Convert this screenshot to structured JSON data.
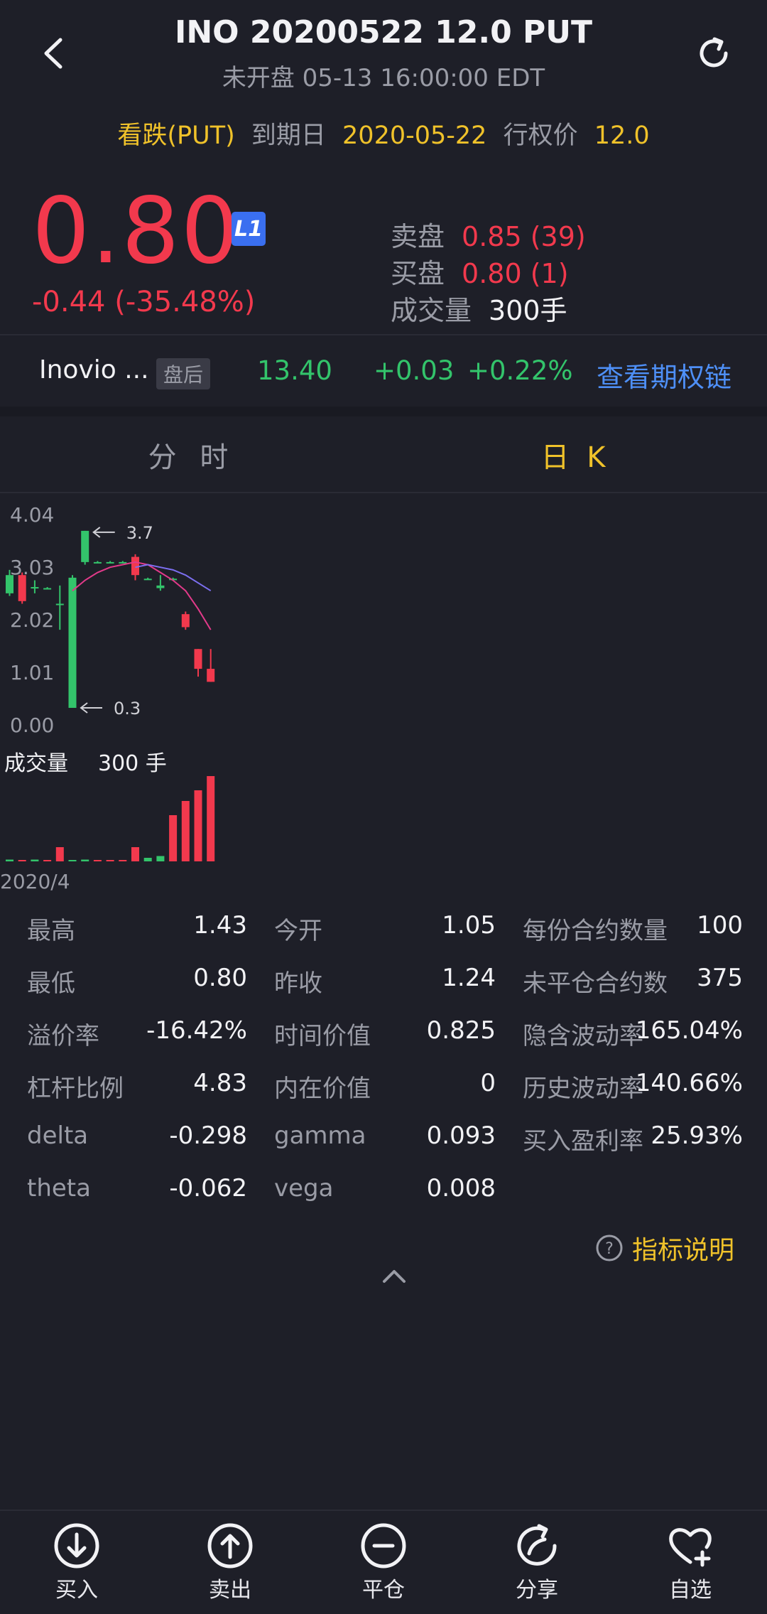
{
  "header": {
    "title": "INO 20200522 12.0 PUT",
    "subtitle": "未开盘 05-13 16:00:00 EDT"
  },
  "contract": {
    "type": "看跌(PUT)",
    "expiry_label": "到期日",
    "expiry_value": "2020-05-22",
    "strike_label": "行权价",
    "strike_value": "12.0"
  },
  "quote": {
    "price": "0.80",
    "level_badge": "L1",
    "change": "-0.44 (-35.48%)",
    "ask_label": "卖盘",
    "ask_value": "0.85 (39)",
    "bid_label": "买盘",
    "bid_value": "0.80 (1)",
    "volume_label": "成交量",
    "volume_value": "300手"
  },
  "underlying": {
    "name": "Inovio ...",
    "session_badge": "盘后",
    "price": "13.40",
    "change": "+0.03",
    "change_pct": "+0.22%",
    "chain_link": "查看期权链"
  },
  "tabs": {
    "intraday": "分 时",
    "daily": "日 K"
  },
  "chart_data": {
    "type": "candlestick",
    "y_ticks": [
      "4.04",
      "3.03",
      "2.02",
      "1.01",
      "0.00"
    ],
    "ylim": [
      0,
      4.04
    ],
    "high_marker": "3.7",
    "low_marker": "0.3",
    "volume_label": "成交量",
    "volume_value": "300 手",
    "x_start_label": "2020/4",
    "candles": [
      {
        "o": 2.5,
        "c": 2.85,
        "h": 2.95,
        "l": 2.45
      },
      {
        "o": 2.85,
        "c": 2.35,
        "h": 2.9,
        "l": 2.3
      },
      {
        "o": 2.6,
        "c": 2.62,
        "h": 2.75,
        "l": 2.5
      },
      {
        "o": 2.6,
        "c": 2.6,
        "h": 2.62,
        "l": 2.58
      },
      {
        "o": 2.3,
        "c": 2.3,
        "h": 2.65,
        "l": 1.8
      },
      {
        "o": 0.3,
        "c": 2.8,
        "h": 2.85,
        "l": 0.3
      },
      {
        "o": 3.1,
        "c": 3.7,
        "h": 3.7,
        "l": 3.05
      },
      {
        "o": 3.1,
        "c": 3.1,
        "h": 3.12,
        "l": 3.08
      },
      {
        "o": 3.1,
        "c": 3.1,
        "h": 3.12,
        "l": 3.08
      },
      {
        "o": 3.1,
        "c": 3.1,
        "h": 3.12,
        "l": 3.08
      },
      {
        "o": 3.2,
        "c": 2.85,
        "h": 3.25,
        "l": 2.75
      },
      {
        "o": 2.78,
        "c": 2.78,
        "h": 2.8,
        "l": 2.76
      },
      {
        "o": 2.6,
        "c": 2.65,
        "h": 2.85,
        "l": 2.55
      },
      {
        "o": 2.78,
        "c": 2.78,
        "h": 2.8,
        "l": 2.76
      },
      {
        "o": 2.1,
        "c": 1.85,
        "h": 2.15,
        "l": 1.8
      },
      {
        "o": 1.43,
        "c": 1.05,
        "h": 1.43,
        "l": 0.9
      },
      {
        "o": 1.05,
        "c": 0.8,
        "h": 1.43,
        "l": 0.8
      }
    ],
    "ma_short": [
      null,
      null,
      null,
      null,
      null,
      2.55,
      2.75,
      2.9,
      3.0,
      3.05,
      3.1,
      3.05,
      2.9,
      2.75,
      2.55,
      2.2,
      1.8
    ],
    "ma_long": [
      null,
      null,
      null,
      null,
      null,
      null,
      null,
      null,
      null,
      null,
      3.0,
      3.05,
      3.0,
      2.95,
      2.85,
      2.7,
      2.55
    ],
    "volumes": [
      5,
      0,
      5,
      0,
      40,
      0,
      5,
      0,
      0,
      0,
      40,
      10,
      15,
      130,
      170,
      200,
      240
    ],
    "volume_up": [
      true,
      false,
      true,
      false,
      false,
      true,
      true,
      false,
      false,
      false,
      false,
      true,
      true,
      false,
      false,
      false,
      false
    ],
    "colors": {
      "up": "#33c46b",
      "down": "#f2394d",
      "ma_short": "#e23a8a",
      "ma_long": "#7c6ff0"
    }
  },
  "stats": [
    [
      {
        "label": "最高",
        "value": "1.43"
      },
      {
        "label": "今开",
        "value": "1.05"
      },
      {
        "label": "每份合约数量",
        "value": "100"
      }
    ],
    [
      {
        "label": "最低",
        "value": "0.80"
      },
      {
        "label": "昨收",
        "value": "1.24"
      },
      {
        "label": "未平仓合约数",
        "value": "375"
      }
    ],
    [
      {
        "label": "溢价率",
        "value": "-16.42%"
      },
      {
        "label": "时间价值",
        "value": "0.825"
      },
      {
        "label": "隐含波动率",
        "value": "165.04%"
      }
    ],
    [
      {
        "label": "杠杆比例",
        "value": "4.83"
      },
      {
        "label": "内在价值",
        "value": "0"
      },
      {
        "label": "历史波动率",
        "value": "140.66%"
      }
    ],
    [
      {
        "label": "delta",
        "value": "-0.298"
      },
      {
        "label": "gamma",
        "value": "0.093"
      },
      {
        "label": "买入盈利率",
        "value": "25.93%"
      }
    ],
    [
      {
        "label": "theta",
        "value": "-0.062"
      },
      {
        "label": "vega",
        "value": "0.008"
      },
      null
    ]
  ],
  "indicator_help": "指标说明",
  "bottom_bar": {
    "buy": "买入",
    "sell": "卖出",
    "close": "平仓",
    "share": "分享",
    "watchlist": "自选"
  }
}
